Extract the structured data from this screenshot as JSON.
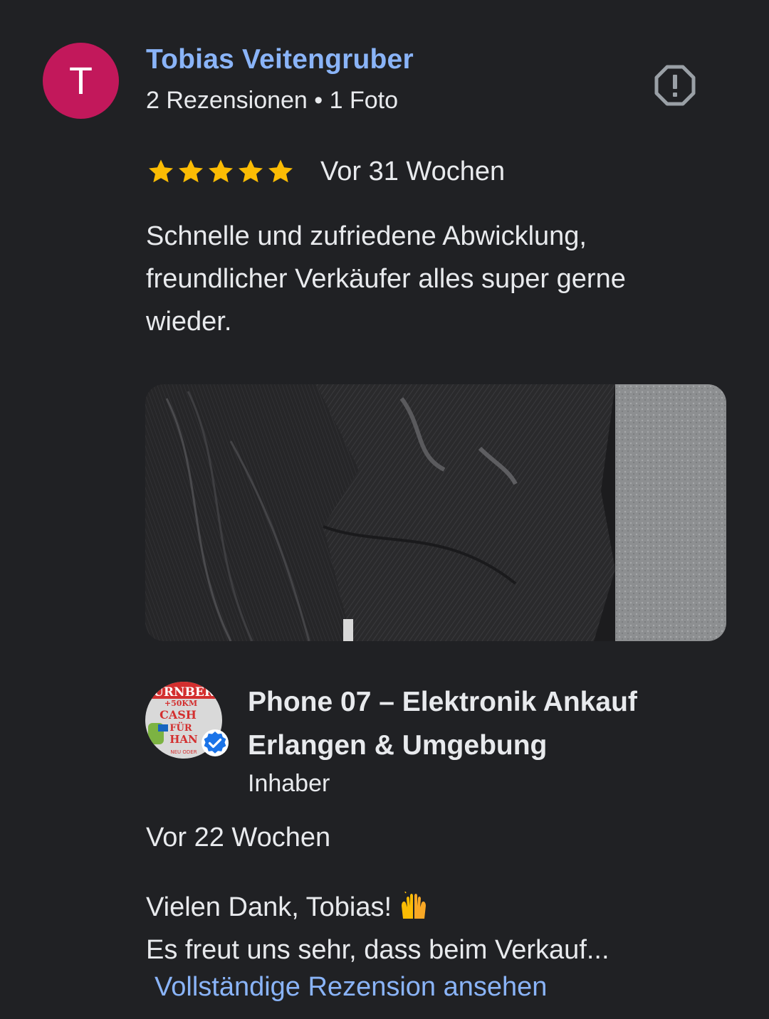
{
  "reviewer": {
    "initial": "T",
    "avatar_color": "#c2185b",
    "name": "Tobias Veitengruber",
    "meta": "2 Rezensionen • 1 Foto"
  },
  "review": {
    "rating": 5,
    "rating_max": 5,
    "time": "Vor 31 Wochen",
    "text": "Schnelle und zufriedene Abwicklung, freundlicher Verkäufer alles super gerne wieder.",
    "photo_icon": "review-photo"
  },
  "report_icon": "report-icon",
  "owner": {
    "name": "Phone 07 – Elektronik Ankauf Erlangen & Umgebung",
    "role": "Inhaber",
    "verified_icon": "verified-check-icon",
    "logo_text": {
      "line1": "ÜRNBER",
      "line2": "+50KM",
      "line3": "CASH",
      "line4": "FÜR",
      "line5": "HAN",
      "line6": "NEU ODER"
    }
  },
  "reply": {
    "time": "Vor 22 Wochen",
    "line1": "Vielen Dank, Tobias!",
    "emoji": "raising-hands-icon",
    "line2": "Es freut uns sehr, dass beim Verkauf...",
    "more_link": "Vollständige Rezension ansehen"
  },
  "colors": {
    "background": "#202124",
    "text": "#e8eaed",
    "link": "#8ab4f8",
    "star": "#fbbc04",
    "verified": "#1a73e8"
  }
}
